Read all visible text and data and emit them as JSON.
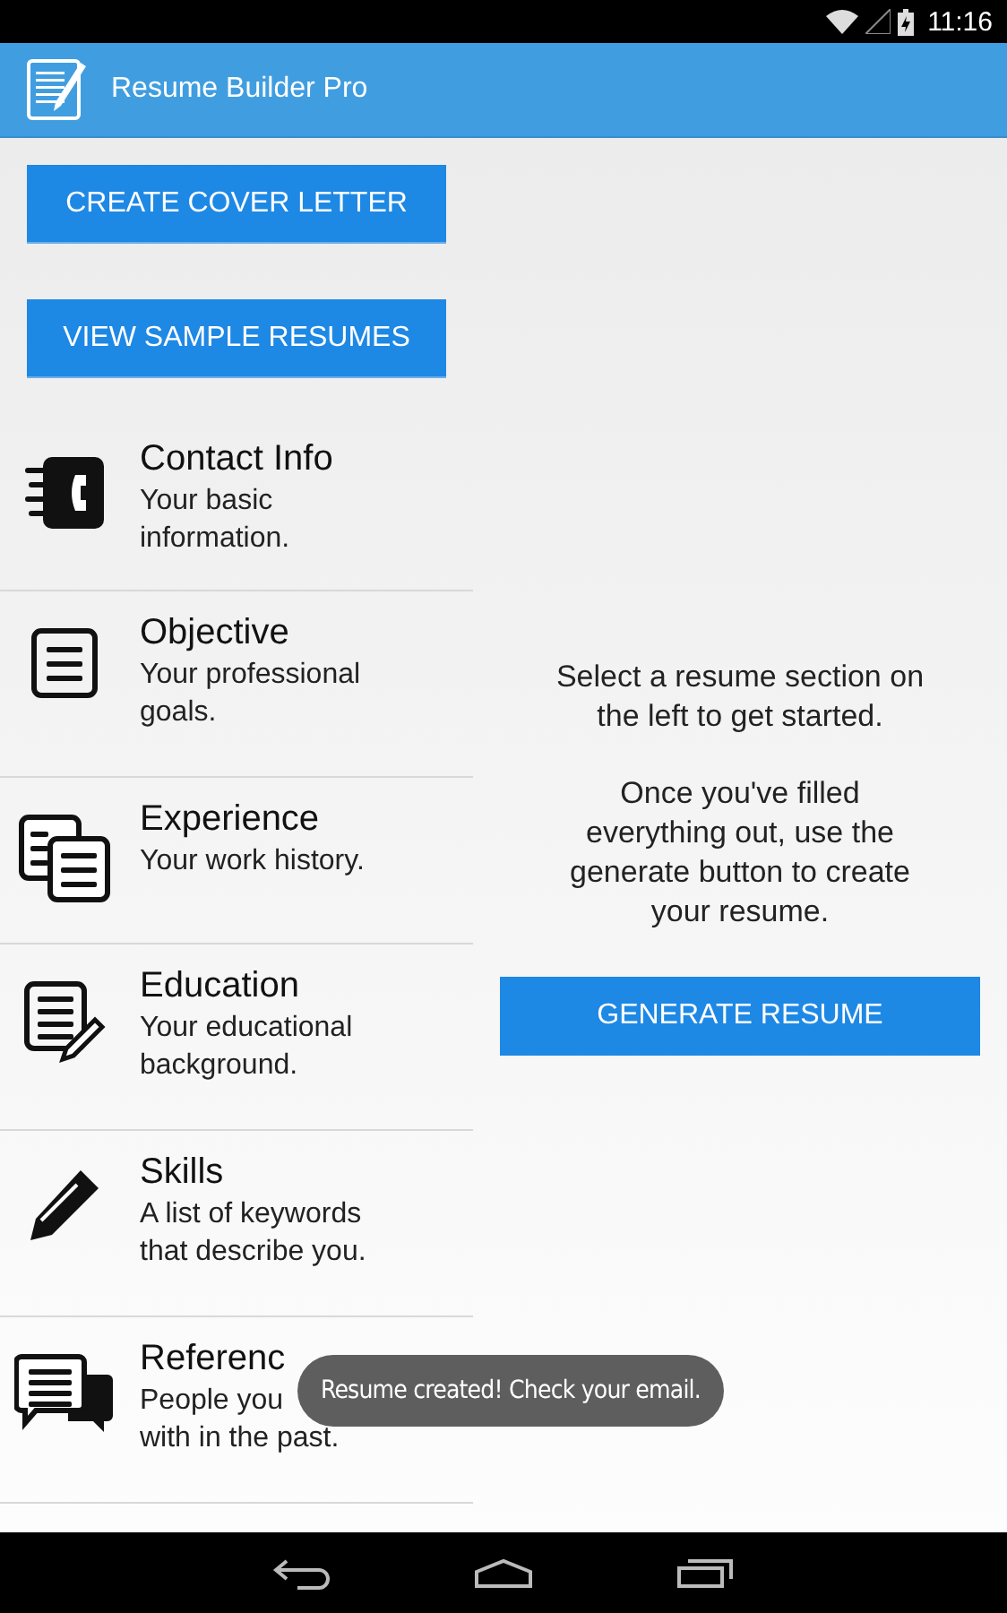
{
  "status_bar": {
    "time": "11:16"
  },
  "app_bar": {
    "title": "Resume Builder Pro"
  },
  "buttons": [
    {
      "label": "CREATE COVER LETTER"
    },
    {
      "label": "VIEW SAMPLE RESUMES"
    }
  ],
  "sections": [
    {
      "kind": "contact",
      "title": "Contact Info",
      "subtitle": "Your basic information."
    },
    {
      "kind": "objective",
      "title": "Objective",
      "subtitle": "Your professional goals."
    },
    {
      "kind": "experience",
      "title": "Experience",
      "subtitle": "Your work history."
    },
    {
      "kind": "education",
      "title": "Education",
      "subtitle": "Your educational background."
    },
    {
      "kind": "skills",
      "title": "Skills",
      "subtitle": "A list of keywords that describe you."
    },
    {
      "kind": "references",
      "title": "Referenc",
      "subtitle_lines": [
        "People you",
        "with in the past."
      ]
    }
  ],
  "detail": {
    "paragraphs": [
      "Select a resume section on the left to get started.",
      "Once you've filled everything out, use the generate button to create your resume."
    ],
    "button": "GENERATE RESUME"
  },
  "toast": "Resume created! Check your email."
}
